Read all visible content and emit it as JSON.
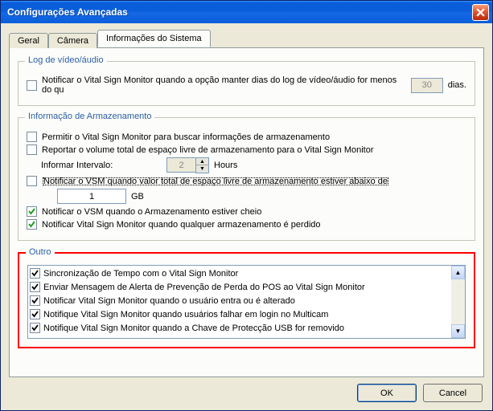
{
  "window": {
    "title": "Configurações Avançadas"
  },
  "tabs": {
    "general": "Geral",
    "camera": "Câmera",
    "system_info": "Informações do Sistema"
  },
  "video_log": {
    "title": "Log de vídeo/áudio",
    "notify_label": "Notificar o Vital Sign Monitor quando a opção manter dias do log de vídeo/áudio for menos do qu",
    "days_value": "30",
    "days_suffix": "dias."
  },
  "storage": {
    "title": "Informação de Armazenamento",
    "allow_label": "Permitir o Vital Sign Monitor para buscar informações de armazenamento",
    "report_label": "Reportar o volume total de espaço livre de armazenamento para o Vital Sign Monitor",
    "interval_label": "Informar Intervalo:",
    "interval_value": "2",
    "interval_unit": "Hours",
    "notify_below_label": "Notificar o VSM quando valor total de espaço livre de armazenamento estiver abaixo de",
    "threshold_value": "1",
    "threshold_unit": "GB",
    "notify_full_label": "Notificar o VSM quando o Armazenamento estiver cheio",
    "notify_lost_label": "Notificar Vital Sign Monitor quando qualquer armazenamento é perdido"
  },
  "other": {
    "title": "Outro",
    "items": [
      "Sincronização de Tempo com o Vital Sign Monitor",
      "Enviar Mensagem de Alerta de Prevenção de Perda do POS ao Vital Sign Monitor",
      "Notificar Vital Sign Monitor quando o usuário entra ou é alterado",
      "Notifique Vital Sign Monitor quando usuários falhar em login no Multicam",
      "Notifique Vital Sign Monitor quando a Chave de Protecção USB for removido"
    ]
  },
  "buttons": {
    "ok": "OK",
    "cancel": "Cancel"
  }
}
